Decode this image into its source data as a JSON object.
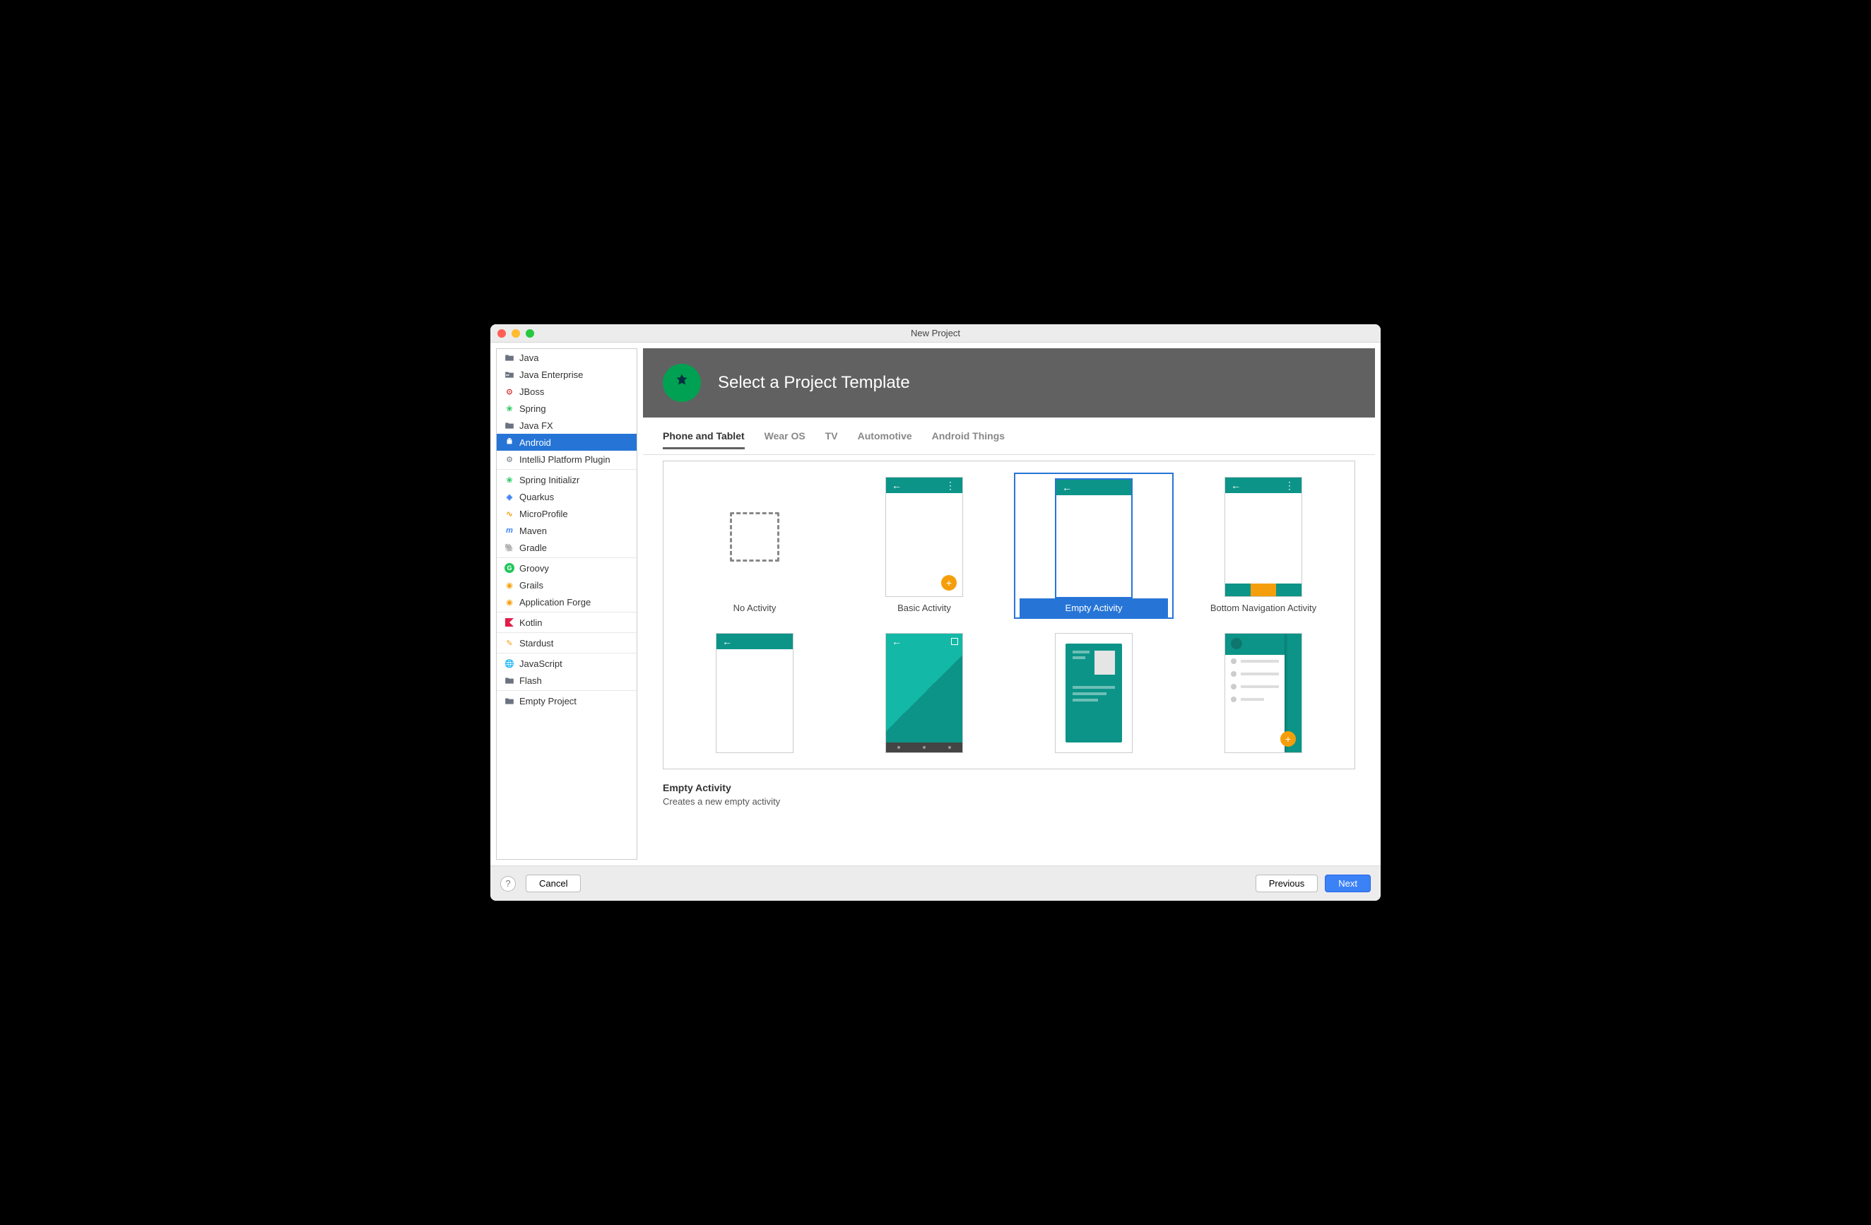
{
  "window": {
    "title": "New Project"
  },
  "sidebar": {
    "groups": [
      [
        {
          "label": "Java",
          "icon": "folder",
          "color": "#6b7280"
        },
        {
          "label": "Java Enterprise",
          "icon": "folder-grid",
          "color": "#6b7280"
        },
        {
          "label": "JBoss",
          "icon": "jboss",
          "color": "#dc2626"
        },
        {
          "label": "Spring",
          "icon": "leaf",
          "color": "#22c55e"
        },
        {
          "label": "Java FX",
          "icon": "folder",
          "color": "#6b7280"
        },
        {
          "label": "Android",
          "icon": "android",
          "color": "#ffffff",
          "selected": true
        },
        {
          "label": "IntelliJ Platform Plugin",
          "icon": "plugin",
          "color": "#6b7280"
        }
      ],
      [
        {
          "label": "Spring Initializr",
          "icon": "leaf-init",
          "color": "#22c55e"
        },
        {
          "label": "Quarkus",
          "icon": "quarkus",
          "color": "#3b82f6"
        },
        {
          "label": "MicroProfile",
          "icon": "microprofile",
          "color": "#f59e0b"
        },
        {
          "label": "Maven",
          "icon": "maven",
          "color": "#3b82f6"
        },
        {
          "label": "Gradle",
          "icon": "gradle",
          "color": "#6b7280"
        }
      ],
      [
        {
          "label": "Groovy",
          "icon": "groovy",
          "color": "#22c55e"
        },
        {
          "label": "Grails",
          "icon": "grails",
          "color": "#f59e0b"
        },
        {
          "label": "Application Forge",
          "icon": "forge",
          "color": "#f59e0b"
        }
      ],
      [
        {
          "label": "Kotlin",
          "icon": "kotlin",
          "color": "#e11d48"
        }
      ],
      [
        {
          "label": "Stardust",
          "icon": "stardust",
          "color": "#f59e0b"
        }
      ],
      [
        {
          "label": "JavaScript",
          "icon": "js",
          "color": "#9ca3af"
        },
        {
          "label": "Flash",
          "icon": "flash",
          "color": "#6b7280"
        }
      ],
      [
        {
          "label": "Empty Project",
          "icon": "folder",
          "color": "#6b7280"
        }
      ]
    ]
  },
  "header": {
    "title": "Select a Project Template"
  },
  "tabs": [
    {
      "label": "Phone and Tablet",
      "active": true
    },
    {
      "label": "Wear OS"
    },
    {
      "label": "TV"
    },
    {
      "label": "Automotive"
    },
    {
      "label": "Android Things"
    }
  ],
  "templates": [
    {
      "label": "No Activity",
      "kind": "none"
    },
    {
      "label": "Basic Activity",
      "kind": "basic"
    },
    {
      "label": "Empty Activity",
      "kind": "empty",
      "selected": true
    },
    {
      "label": "Bottom Navigation Activity",
      "kind": "bottomnav"
    },
    {
      "label": "",
      "kind": "emptybar"
    },
    {
      "label": "",
      "kind": "fullscreen"
    },
    {
      "label": "",
      "kind": "card"
    },
    {
      "label": "",
      "kind": "drawer"
    }
  ],
  "description": {
    "title": "Empty Activity",
    "text": "Creates a new empty activity"
  },
  "buttons": {
    "help": "?",
    "cancel": "Cancel",
    "previous": "Previous",
    "next": "Next"
  }
}
